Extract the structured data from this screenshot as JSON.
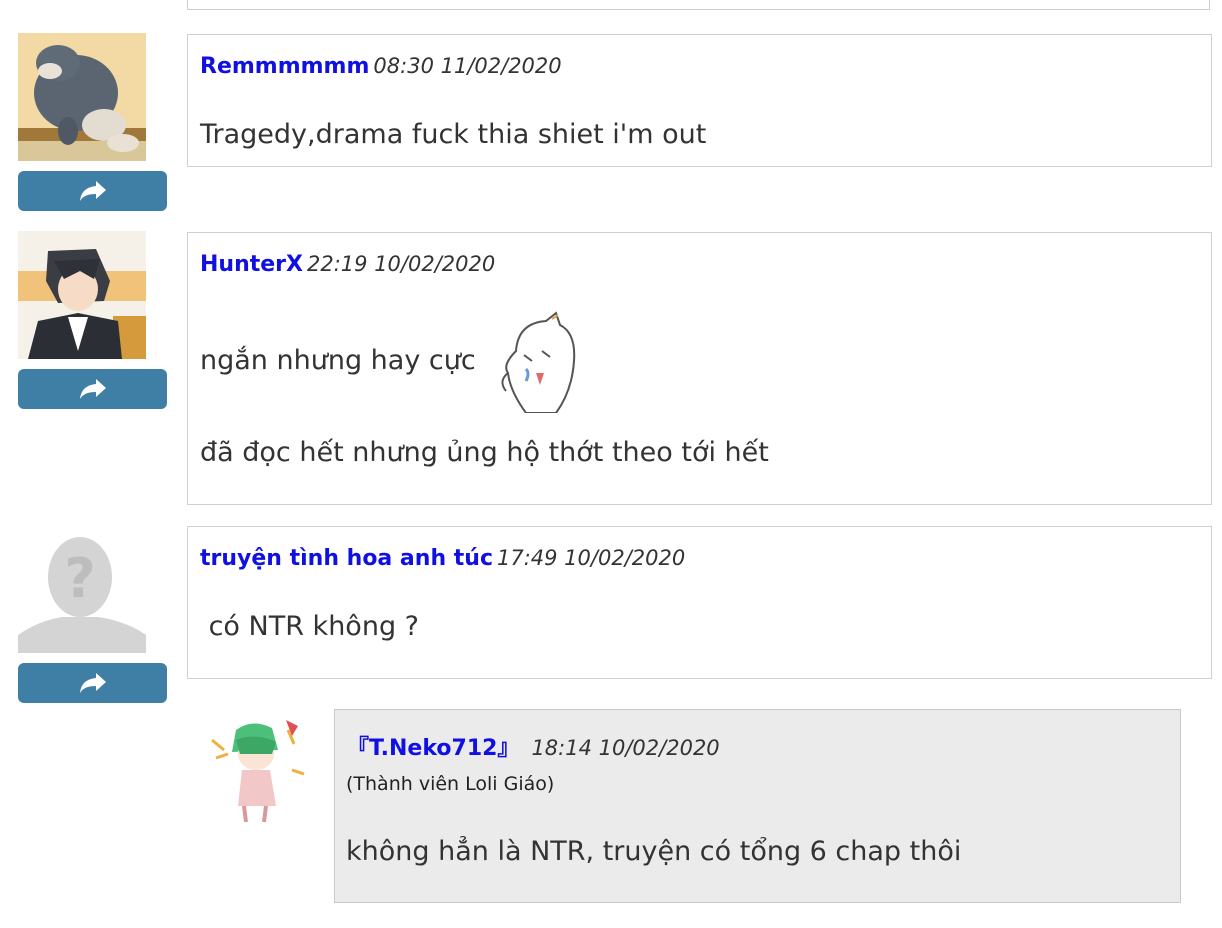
{
  "comments": [
    {
      "username": "Remmmmmm",
      "time": "08:30 11/02/2020",
      "lines": [
        "Tragedy,drama fuck thia shiet i'm out"
      ]
    },
    {
      "username": "HunterX",
      "time": "22:19 10/02/2020",
      "lines": [
        "ngắn nhưng hay cực",
        "đã đọc hết nhưng ủng hộ thớt theo tới hết"
      ]
    },
    {
      "username": "truyện tình hoa anh túc",
      "time": "17:49 10/02/2020",
      "lines": [
        " có NTR không ?"
      ]
    }
  ],
  "reply": {
    "username": "『T.Neko712』",
    "time": "18:14 10/02/2020",
    "title": "(Thành viên Loli Giáo)",
    "text": "không hẳn là NTR, truyện có tổng 6 chap thôi"
  },
  "icons": {
    "reply_button": "share-arrow-icon",
    "emoji": "crying-cat-sticker-icon"
  },
  "colors": {
    "username": "#1010e0",
    "reply_button_bg": "#3f7fa6",
    "reply_box_bg": "#ebebeb",
    "border": "#d0d0d0"
  }
}
